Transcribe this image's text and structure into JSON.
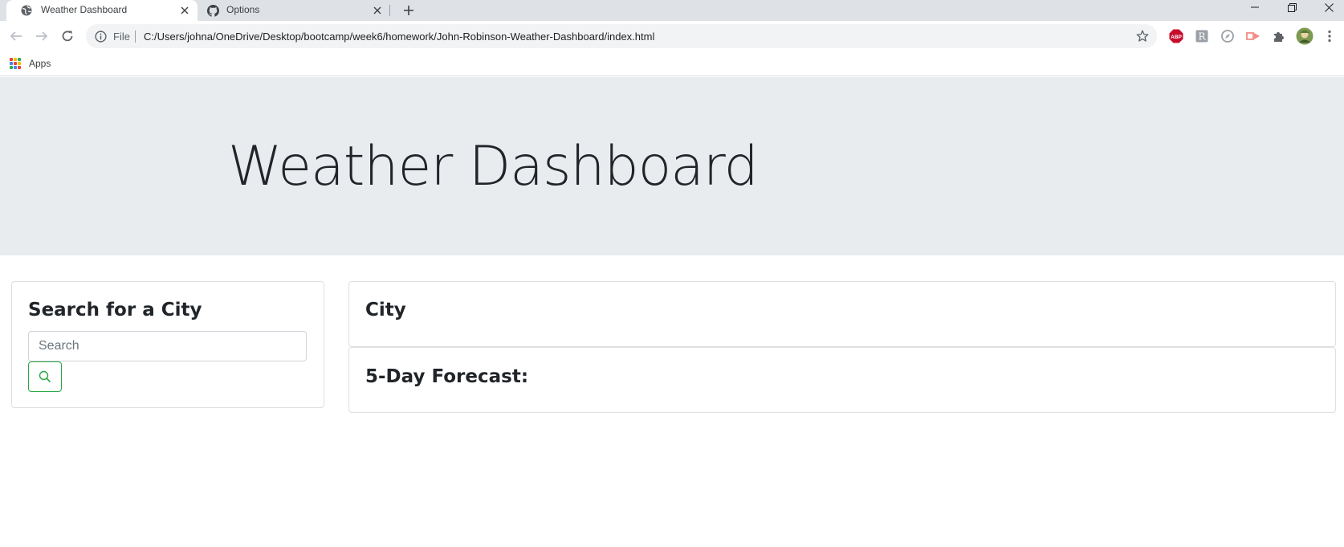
{
  "browser": {
    "tabs": [
      {
        "title": "Weather Dashboard",
        "icon": "globe-icon",
        "active": true
      },
      {
        "title": "Options",
        "icon": "github-icon",
        "active": false
      }
    ],
    "address": {
      "scheme_label": "File",
      "url": "C:/Users/johna/OneDrive/Desktop/bootcamp/week6/homework/John-Robinson-Weather-Dashboard/index.html"
    },
    "extensions": [
      "adblock-plus-icon",
      "extension-r-icon",
      "compass-extension-icon",
      "cast-extension-icon",
      "puzzle-icon",
      "profile-avatar-icon",
      "kebab-menu-icon"
    ],
    "bookmarks": [
      {
        "label": "Apps",
        "icon": "apps-grid-icon"
      }
    ]
  },
  "page": {
    "title": "Weather Dashboard",
    "search": {
      "heading": "Search for a City",
      "placeholder": "Search",
      "button_icon": "search-icon"
    },
    "current": {
      "heading": "City"
    },
    "forecast": {
      "heading": "5-Day Forecast:"
    }
  },
  "colors": {
    "jumbotron_bg": "#e9ecef",
    "search_button_border": "#28a745",
    "tabstrip_bg": "#dee1e6",
    "abp_red": "#c70d2c"
  }
}
